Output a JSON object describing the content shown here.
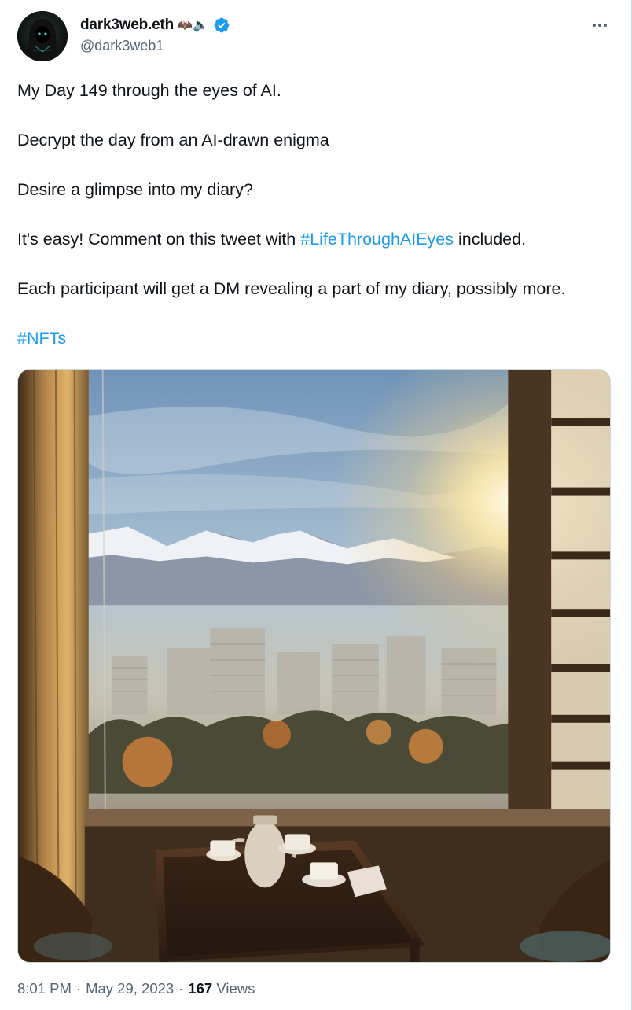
{
  "author": {
    "display_name": "dark3web.eth",
    "name_emoji": "🦇🔈",
    "handle": "@dark3web1",
    "verified": true,
    "avatar_icon": "hooded-figure-avatar"
  },
  "tweet": {
    "text_lines": [
      "My Day 149 through the eyes of AI.",
      "Decrypt the day from an AI-drawn enigma",
      "Desire a glimpse into my diary?"
    ],
    "easy_line": {
      "before": "It's easy! Comment on this tweet with ",
      "hashtag": "#LifeThroughAIEyes",
      "after": " included."
    },
    "participant_line": "Each participant will get a DM revealing a part of my diary, possibly more.",
    "footer_hashtag": "#NFTs",
    "media_alt": "Window view of snowy mountains at sunrise over city apartment blocks, with a table and teapot in the foreground"
  },
  "meta": {
    "time": "8:01 PM",
    "separator": "·",
    "date": "May 29, 2023",
    "views_count": "167",
    "views_label": "Views"
  },
  "colors": {
    "link": "#1d9bf0",
    "secondary_text": "#536471",
    "primary_text": "#0f1419",
    "verified_badge": "#1d9bf0"
  }
}
